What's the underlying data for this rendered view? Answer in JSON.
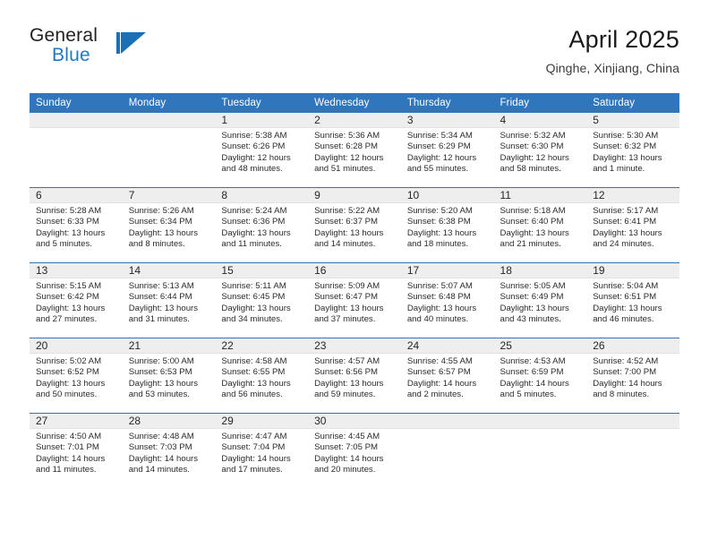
{
  "brand": {
    "name_top": "General",
    "name_bottom": "Blue",
    "accent_color": "#2079c7"
  },
  "header": {
    "title": "April 2025",
    "subtitle": "Qinghe, Xinjiang, China"
  },
  "calendar": {
    "header_bg": "#2f76bc",
    "daynum_bg": "#eeeeee",
    "weekdays": [
      "Sunday",
      "Monday",
      "Tuesday",
      "Wednesday",
      "Thursday",
      "Friday",
      "Saturday"
    ],
    "weeks": [
      [
        {
          "day": "",
          "empty": true
        },
        {
          "day": "",
          "empty": true
        },
        {
          "day": "1",
          "sunrise": "Sunrise: 5:38 AM",
          "sunset": "Sunset: 6:26 PM",
          "daylight": "Daylight: 12 hours and 48 minutes."
        },
        {
          "day": "2",
          "sunrise": "Sunrise: 5:36 AM",
          "sunset": "Sunset: 6:28 PM",
          "daylight": "Daylight: 12 hours and 51 minutes."
        },
        {
          "day": "3",
          "sunrise": "Sunrise: 5:34 AM",
          "sunset": "Sunset: 6:29 PM",
          "daylight": "Daylight: 12 hours and 55 minutes."
        },
        {
          "day": "4",
          "sunrise": "Sunrise: 5:32 AM",
          "sunset": "Sunset: 6:30 PM",
          "daylight": "Daylight: 12 hours and 58 minutes."
        },
        {
          "day": "5",
          "sunrise": "Sunrise: 5:30 AM",
          "sunset": "Sunset: 6:32 PM",
          "daylight": "Daylight: 13 hours and 1 minute."
        }
      ],
      [
        {
          "day": "6",
          "sunrise": "Sunrise: 5:28 AM",
          "sunset": "Sunset: 6:33 PM",
          "daylight": "Daylight: 13 hours and 5 minutes."
        },
        {
          "day": "7",
          "sunrise": "Sunrise: 5:26 AM",
          "sunset": "Sunset: 6:34 PM",
          "daylight": "Daylight: 13 hours and 8 minutes."
        },
        {
          "day": "8",
          "sunrise": "Sunrise: 5:24 AM",
          "sunset": "Sunset: 6:36 PM",
          "daylight": "Daylight: 13 hours and 11 minutes."
        },
        {
          "day": "9",
          "sunrise": "Sunrise: 5:22 AM",
          "sunset": "Sunset: 6:37 PM",
          "daylight": "Daylight: 13 hours and 14 minutes."
        },
        {
          "day": "10",
          "sunrise": "Sunrise: 5:20 AM",
          "sunset": "Sunset: 6:38 PM",
          "daylight": "Daylight: 13 hours and 18 minutes."
        },
        {
          "day": "11",
          "sunrise": "Sunrise: 5:18 AM",
          "sunset": "Sunset: 6:40 PM",
          "daylight": "Daylight: 13 hours and 21 minutes."
        },
        {
          "day": "12",
          "sunrise": "Sunrise: 5:17 AM",
          "sunset": "Sunset: 6:41 PM",
          "daylight": "Daylight: 13 hours and 24 minutes."
        }
      ],
      [
        {
          "day": "13",
          "sunrise": "Sunrise: 5:15 AM",
          "sunset": "Sunset: 6:42 PM",
          "daylight": "Daylight: 13 hours and 27 minutes."
        },
        {
          "day": "14",
          "sunrise": "Sunrise: 5:13 AM",
          "sunset": "Sunset: 6:44 PM",
          "daylight": "Daylight: 13 hours and 31 minutes."
        },
        {
          "day": "15",
          "sunrise": "Sunrise: 5:11 AM",
          "sunset": "Sunset: 6:45 PM",
          "daylight": "Daylight: 13 hours and 34 minutes."
        },
        {
          "day": "16",
          "sunrise": "Sunrise: 5:09 AM",
          "sunset": "Sunset: 6:47 PM",
          "daylight": "Daylight: 13 hours and 37 minutes."
        },
        {
          "day": "17",
          "sunrise": "Sunrise: 5:07 AM",
          "sunset": "Sunset: 6:48 PM",
          "daylight": "Daylight: 13 hours and 40 minutes."
        },
        {
          "day": "18",
          "sunrise": "Sunrise: 5:05 AM",
          "sunset": "Sunset: 6:49 PM",
          "daylight": "Daylight: 13 hours and 43 minutes."
        },
        {
          "day": "19",
          "sunrise": "Sunrise: 5:04 AM",
          "sunset": "Sunset: 6:51 PM",
          "daylight": "Daylight: 13 hours and 46 minutes."
        }
      ],
      [
        {
          "day": "20",
          "sunrise": "Sunrise: 5:02 AM",
          "sunset": "Sunset: 6:52 PM",
          "daylight": "Daylight: 13 hours and 50 minutes."
        },
        {
          "day": "21",
          "sunrise": "Sunrise: 5:00 AM",
          "sunset": "Sunset: 6:53 PM",
          "daylight": "Daylight: 13 hours and 53 minutes."
        },
        {
          "day": "22",
          "sunrise": "Sunrise: 4:58 AM",
          "sunset": "Sunset: 6:55 PM",
          "daylight": "Daylight: 13 hours and 56 minutes."
        },
        {
          "day": "23",
          "sunrise": "Sunrise: 4:57 AM",
          "sunset": "Sunset: 6:56 PM",
          "daylight": "Daylight: 13 hours and 59 minutes."
        },
        {
          "day": "24",
          "sunrise": "Sunrise: 4:55 AM",
          "sunset": "Sunset: 6:57 PM",
          "daylight": "Daylight: 14 hours and 2 minutes."
        },
        {
          "day": "25",
          "sunrise": "Sunrise: 4:53 AM",
          "sunset": "Sunset: 6:59 PM",
          "daylight": "Daylight: 14 hours and 5 minutes."
        },
        {
          "day": "26",
          "sunrise": "Sunrise: 4:52 AM",
          "sunset": "Sunset: 7:00 PM",
          "daylight": "Daylight: 14 hours and 8 minutes."
        }
      ],
      [
        {
          "day": "27",
          "sunrise": "Sunrise: 4:50 AM",
          "sunset": "Sunset: 7:01 PM",
          "daylight": "Daylight: 14 hours and 11 minutes."
        },
        {
          "day": "28",
          "sunrise": "Sunrise: 4:48 AM",
          "sunset": "Sunset: 7:03 PM",
          "daylight": "Daylight: 14 hours and 14 minutes."
        },
        {
          "day": "29",
          "sunrise": "Sunrise: 4:47 AM",
          "sunset": "Sunset: 7:04 PM",
          "daylight": "Daylight: 14 hours and 17 minutes."
        },
        {
          "day": "30",
          "sunrise": "Sunrise: 4:45 AM",
          "sunset": "Sunset: 7:05 PM",
          "daylight": "Daylight: 14 hours and 20 minutes."
        },
        {
          "day": "",
          "empty": true
        },
        {
          "day": "",
          "empty": true
        },
        {
          "day": "",
          "empty": true
        }
      ]
    ]
  }
}
